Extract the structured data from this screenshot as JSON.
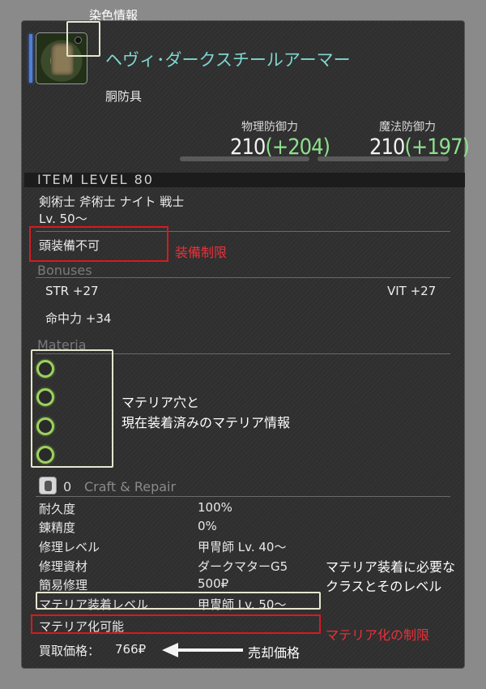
{
  "annotations": {
    "dye_info": "染色情報",
    "equip_restriction": "装備制限",
    "materia_slots_line1": "マテリア穴と",
    "materia_slots_line2": "現在装着済みのマテリア情報",
    "materia_req_line1": "マテリア装着に必要な",
    "materia_req_line2": "クラスとそのレベル",
    "materialize_restriction": "マテリア化の制限",
    "sell_price": "売却価格"
  },
  "item": {
    "name": "ヘヴィ･ダークスチールアーマー",
    "category": "胴防具",
    "icon": "armor-icon"
  },
  "stats": {
    "physical_label": "物理防御力",
    "physical_base": "210",
    "physical_bonus": "(+204)",
    "magic_label": "魔法防御力",
    "magic_base": "210",
    "magic_bonus": "(+197)"
  },
  "item_level": "ITEM LEVEL 80",
  "classes": "剣術士 斧術士 ナイト 戦士",
  "level_req": "Lv. 50～",
  "restriction": "頭装備不可",
  "bonuses": {
    "title": "Bonuses",
    "str": "STR +27",
    "vit": "VIT +27",
    "accuracy": "命中力 +34"
  },
  "materia": {
    "title": "Materia",
    "slot_count": 4
  },
  "craft": {
    "count": "0",
    "title": "Craft & Repair",
    "rows": [
      {
        "label": "耐久度",
        "value": "100%"
      },
      {
        "label": "錬精度",
        "value": "0%"
      },
      {
        "label": "修理レベル",
        "value": "甲冑師 Lv. 40～"
      },
      {
        "label": "修理資材",
        "value": "ダークマターG5"
      },
      {
        "label": "簡易修理",
        "value": "500₽"
      },
      {
        "label": "マテリア装着レベル",
        "value": "甲冑師 Lv. 50～"
      }
    ]
  },
  "materializable": "マテリア化可能",
  "price": {
    "label": "買取価格：",
    "value": "766₽"
  },
  "colors": {
    "item_name": "#7fd5d0",
    "bonus_green": "#8de08d",
    "materia_ring": "#9ed060",
    "annotation_red": "#e8313a",
    "rarity_blue": "#4f7fd6"
  }
}
